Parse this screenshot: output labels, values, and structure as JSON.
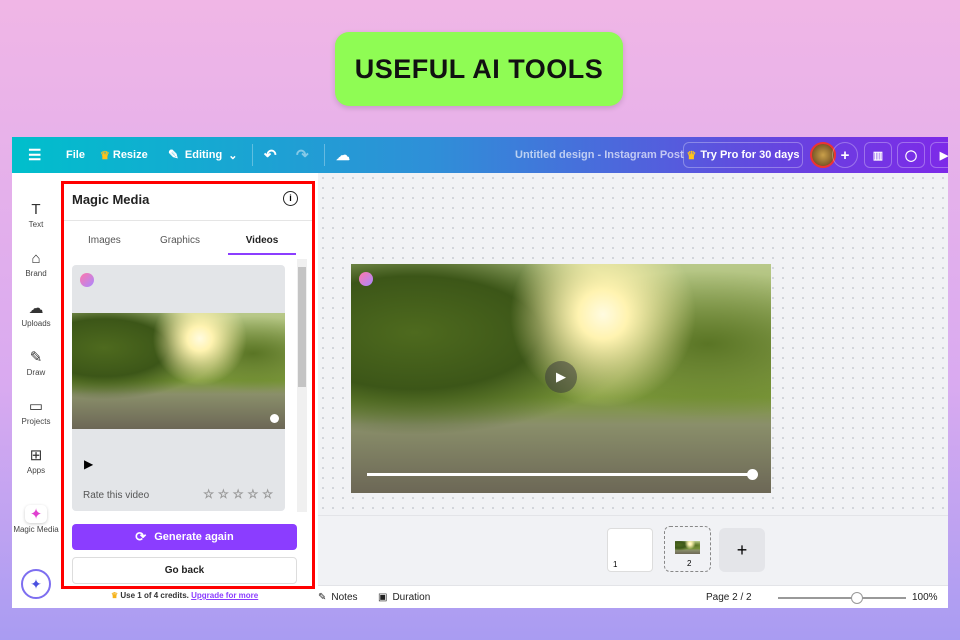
{
  "banner": "USEFUL AI TOOLS",
  "topbar": {
    "file": "File",
    "resize": "Resize",
    "editing": "Editing",
    "title": "Untitled design - Instagram Post",
    "try_pro": "Try Pro for 30 days"
  },
  "rail": [
    {
      "label": "Text",
      "icon": "T"
    },
    {
      "label": "Brand",
      "icon": "⌂"
    },
    {
      "label": "Uploads",
      "icon": "☁"
    },
    {
      "label": "Draw",
      "icon": "✎"
    },
    {
      "label": "Projects",
      "icon": "▭"
    },
    {
      "label": "Apps",
      "icon": "⊞"
    },
    {
      "label": "Magic Media",
      "icon": "✦"
    }
  ],
  "panel": {
    "title": "Magic Media",
    "tabs": [
      "Images",
      "Graphics",
      "Videos"
    ],
    "active_tab": "Videos",
    "rate": "Rate this video",
    "generate": "Generate again",
    "go_back": "Go back",
    "credits": "Use 1 of 4 credits.",
    "upgrade": "Upgrade for more"
  },
  "pages": {
    "p1": "1",
    "p2": "2",
    "page_label": "Page 2 / 2",
    "zoom": "100%",
    "zoom_level": 0.5
  },
  "bottom": {
    "notes": "Notes",
    "duration": "Duration"
  }
}
